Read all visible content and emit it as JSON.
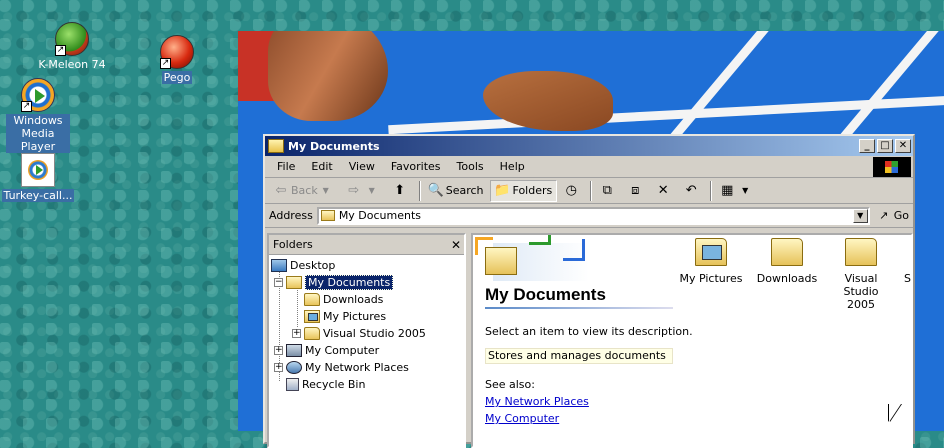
{
  "desktop": {
    "icons": [
      {
        "label": "K-Meleon 74",
        "icon": "k-meleon-icon"
      },
      {
        "label": "Pego",
        "icon": "pego-icon"
      },
      {
        "label": "Windows Media Player",
        "icon": "windows-media-player-icon"
      },
      {
        "label": "Turkey-call...",
        "icon": "media-file-icon"
      }
    ]
  },
  "window": {
    "title": "My Documents",
    "buttons": {
      "minimize": "_",
      "maximize": "□",
      "close": "✕"
    },
    "menu": [
      "File",
      "Edit",
      "View",
      "Favorites",
      "Tools",
      "Help"
    ],
    "toolbar": {
      "back": "Back",
      "search": "Search",
      "folders": "Folders"
    },
    "address": {
      "label": "Address",
      "value": "My Documents",
      "go": "Go"
    },
    "folders_pane": {
      "header": "Folders",
      "tree": [
        {
          "label": "Desktop",
          "level": 0,
          "expander": "",
          "icon": "desktop-icon"
        },
        {
          "label": "My Documents",
          "level": 1,
          "expander": "−",
          "icon": "my-documents-icon",
          "selected": true
        },
        {
          "label": "Downloads",
          "level": 2,
          "expander": "",
          "icon": "folder-icon"
        },
        {
          "label": "My Pictures",
          "level": 2,
          "expander": "",
          "icon": "pictures-folder-icon"
        },
        {
          "label": "Visual Studio 2005",
          "level": 2,
          "expander": "+",
          "icon": "folder-icon"
        },
        {
          "label": "My Computer",
          "level": 1,
          "expander": "+",
          "icon": "computer-icon"
        },
        {
          "label": "My Network Places",
          "level": 1,
          "expander": "+",
          "icon": "network-icon"
        },
        {
          "label": "Recycle Bin",
          "level": 1,
          "expander": "",
          "icon": "recycle-bin-icon"
        }
      ]
    },
    "details": {
      "title": "My Documents",
      "prompt": "Select an item to view its description.",
      "description": "Stores and manages documents",
      "see_also": "See also:",
      "links": [
        "My Network Places",
        "My Computer"
      ]
    },
    "items": [
      {
        "name": "My Pictures",
        "icon": "pictures-folder-icon"
      },
      {
        "name": "Downloads",
        "icon": "folder-icon"
      },
      {
        "name": "Visual Studio 2005",
        "icon": "folder-icon"
      },
      {
        "name": "S",
        "icon": "folder-icon"
      }
    ]
  }
}
